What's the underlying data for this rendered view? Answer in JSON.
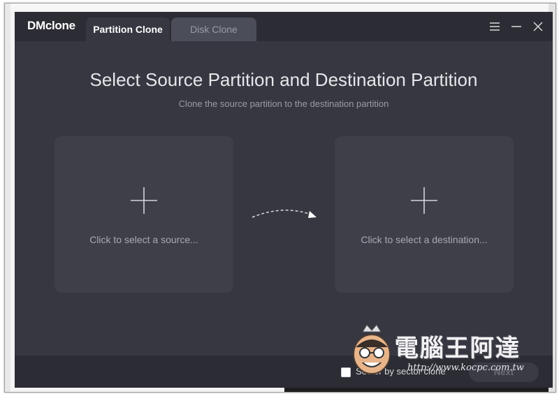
{
  "app": {
    "brand": "DMclone",
    "tabs": [
      {
        "label": "Partition Clone",
        "active": true
      },
      {
        "label": "Disk Clone",
        "active": false
      }
    ],
    "window_controls": [
      "menu-icon",
      "minimize-icon",
      "close-icon"
    ]
  },
  "main": {
    "title": "Select Source Partition and Destination Partition",
    "subtitle": "Clone the source partition to the destination partition",
    "source_label": "Click to select a source...",
    "destination_label": "Click to select a destination..."
  },
  "footer": {
    "sector_label": "Sector by sector clone",
    "sector_checked": false,
    "next_label": "Next"
  },
  "watermark": {
    "title": "電腦王阿達",
    "url": "http://www.kocpc.com.tw"
  },
  "colors": {
    "background": "#373741",
    "titlebar": "#2c2c34",
    "card": "#3f3f4a",
    "inactive_tab": "#4b4d58"
  }
}
